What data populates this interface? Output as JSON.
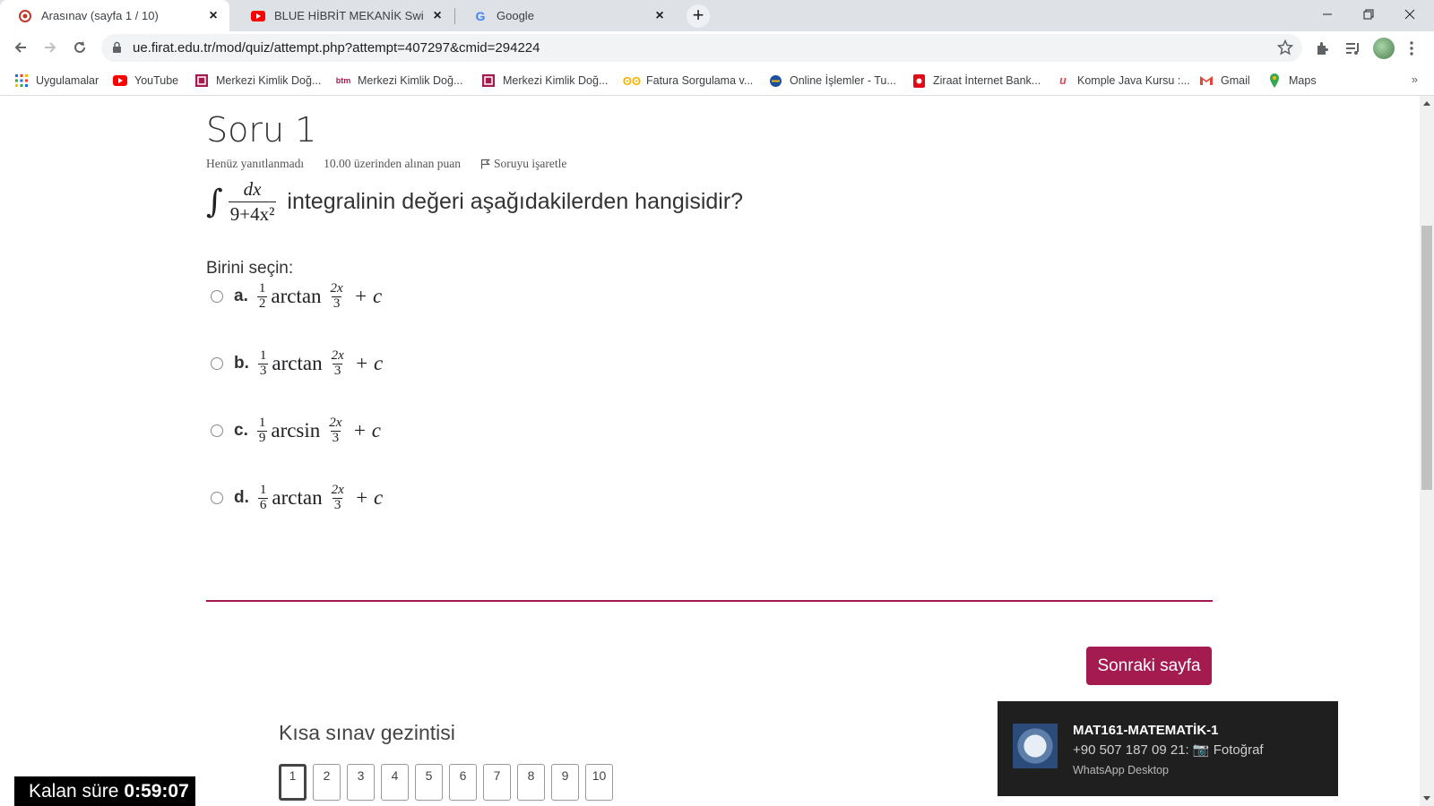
{
  "browser": {
    "tabs": [
      {
        "title": "Arasınav (sayfa 1 / 10)",
        "favicon": "moodle-icon",
        "active": true
      },
      {
        "title": "BLUE HİBRİT MEKANİK Switch de",
        "favicon": "youtube-icon",
        "active": false
      },
      {
        "title": "Google",
        "favicon": "google-icon",
        "active": false
      }
    ],
    "url": "ue.firat.edu.tr/mod/quiz/attempt.php?attempt=407297&cmid=294224",
    "bookmarks": [
      {
        "label": "Uygulamalar",
        "icon": "apps-grid-icon"
      },
      {
        "label": "YouTube",
        "icon": "youtube-icon"
      },
      {
        "label": "Merkezi Kimlik Doğ...",
        "icon": "mkd-icon"
      },
      {
        "label": "Merkezi Kimlik Doğ...",
        "icon": "btm-icon"
      },
      {
        "label": "Merkezi Kimlik Doğ...",
        "icon": "mkd-icon"
      },
      {
        "label": "Fatura Sorgulama v...",
        "icon": "fatura-icon"
      },
      {
        "label": "Online İşlemler - Tu...",
        "icon": "globe-icon"
      },
      {
        "label": "Ziraat İnternet Bank...",
        "icon": "ziraat-icon"
      },
      {
        "label": "Komple Java Kursu :...",
        "icon": "udemy-icon"
      },
      {
        "label": "Gmail",
        "icon": "gmail-icon"
      },
      {
        "label": "Maps",
        "icon": "maps-icon"
      }
    ],
    "more": "»"
  },
  "question": {
    "title": "Soru 1",
    "status": "Henüz yanıtlanmadı",
    "points": "10.00 üzerinden alınan puan",
    "flag_label": "Soruyu işaretle",
    "integral_numerator": "dx",
    "integral_denominator": "9+4x²",
    "text": "integralinin değeri aşağıdakilerden hangisidir?",
    "choose_label": "Birini seçin:",
    "answers": [
      {
        "letter": "a.",
        "coef_num": "1",
        "coef_den": "2",
        "fn": "arctan",
        "arg_num": "2x",
        "arg_den": "3",
        "tail": "+ c"
      },
      {
        "letter": "b.",
        "coef_num": "1",
        "coef_den": "3",
        "fn": "arctan",
        "arg_num": "2x",
        "arg_den": "3",
        "tail": "+ c"
      },
      {
        "letter": "c.",
        "coef_num": "1",
        "coef_den": "9",
        "fn": "arcsin",
        "arg_num": "2x",
        "arg_den": "3",
        "tail": "+ c"
      },
      {
        "letter": "d.",
        "coef_num": "1",
        "coef_den": "6",
        "fn": "arctan",
        "arg_num": "2x",
        "arg_den": "3",
        "tail": "+ c"
      }
    ]
  },
  "next_button": "Sonraki sayfa",
  "quiz_nav": {
    "title": "Kısa sınav gezintisi",
    "pages": [
      "1",
      "2",
      "3",
      "4",
      "5",
      "6",
      "7",
      "8",
      "9",
      "10"
    ],
    "current": "1"
  },
  "timer": {
    "label": "Kalan süre",
    "value": "0:59:07"
  },
  "notification": {
    "name": "MAT161-MATEMATİK-1",
    "message": "+90 507 187 09 21: 📷 Fotoğraf",
    "app": "WhatsApp Desktop"
  },
  "colors": {
    "accent": "#a31b4f",
    "divider": "#a0194d"
  }
}
